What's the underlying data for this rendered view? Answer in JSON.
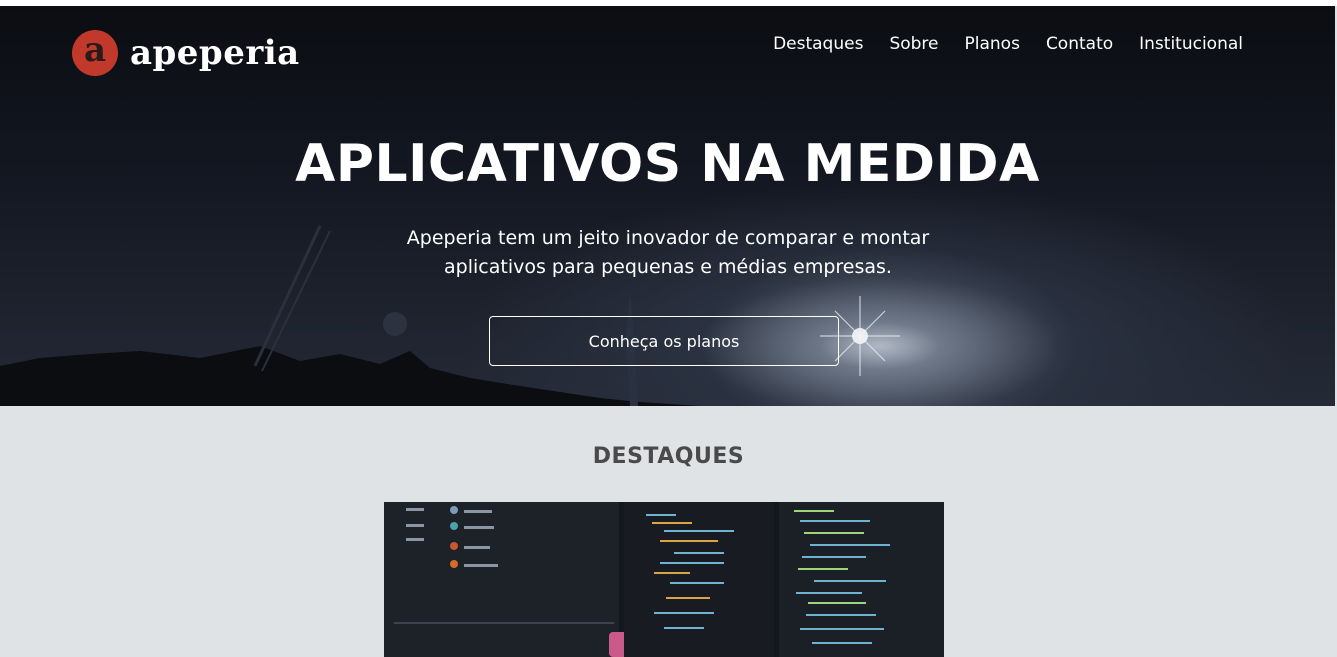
{
  "brand": {
    "logo_letter": "a",
    "name": "apeperia",
    "color": "#c0392b"
  },
  "nav": [
    {
      "label": "Destaques"
    },
    {
      "label": "Sobre"
    },
    {
      "label": "Planos"
    },
    {
      "label": "Contato"
    },
    {
      "label": "Institucional"
    }
  ],
  "hero": {
    "title": "APLICATIVOS NA MEDIDA",
    "subtitle_line1": "Apeperia tem um jeito inovador de comparar e montar",
    "subtitle_line2": "aplicativos para pequenas e médias empresas.",
    "cta_label": "Conheça os planos"
  },
  "highlights": {
    "title": "DESTAQUES",
    "image": "code-editor-screens-photo"
  }
}
